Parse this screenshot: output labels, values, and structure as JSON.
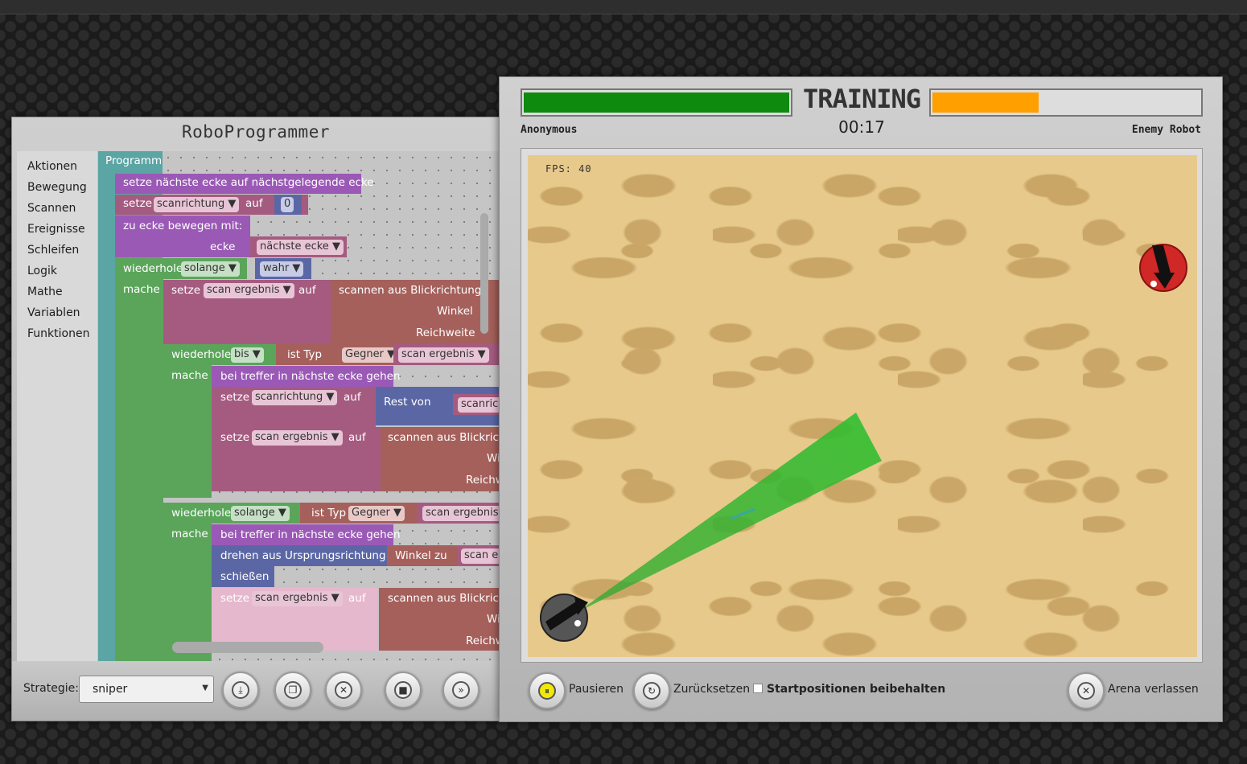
{
  "programmer": {
    "title": "RoboProgrammer",
    "categories": [
      "Aktionen",
      "Bewegung",
      "Scannen",
      "Ereignisse",
      "Schleifen",
      "Logik",
      "Mathe",
      "Variablen",
      "Funktionen"
    ],
    "blocks": {
      "programm": "Programm",
      "nearest_corner": "setze nächste ecke auf nächstgelegende ecke",
      "setze": "setze",
      "auf": "auf",
      "scanrichtung": "scanrichtung",
      "zero": "0",
      "move_corner": "zu ecke bewegen  mit:",
      "ecke": "ecke",
      "naechste_ecke": "nächste ecke",
      "wiederhole": "wiederhole",
      "solange": "solange",
      "wahr": "wahr",
      "mache": "mache",
      "scan_ergebnis": "scan ergebnis",
      "scannen_aus": "scannen aus Blickrichtung",
      "scannen_aus_cut": "scannen aus Blickricht",
      "winkel": "Winkel",
      "winkel_cut": "Wi",
      "reichweite": "Reichweite",
      "reichweite_cut": "Reichw",
      "bis": "bis",
      "ist_typ": "ist Typ",
      "gegner": "Gegner",
      "bei_treffer": "bei treffer in nächste ecke gehen",
      "rest_von": "Rest von",
      "scanric": "scanric",
      "drehen": "drehen aus Ursprungsrichtung",
      "winkel_zu": "Winkel zu",
      "scan_e": "scan e",
      "schiessen": "schießen"
    },
    "strategy_label": "Strategie:",
    "strategy_value": "sniper",
    "buttons": [
      {
        "name": "download-icon",
        "glyph": "⤓"
      },
      {
        "name": "copy-icon",
        "glyph": "❐"
      },
      {
        "name": "close-icon",
        "glyph": "✕"
      },
      {
        "name": "stop-icon",
        "glyph": "■"
      },
      {
        "name": "fast-forward-icon",
        "glyph": "»"
      }
    ]
  },
  "arena": {
    "title": "TRAINING",
    "timer": "00:17",
    "player": {
      "name": "Anonymous",
      "health": 1.0,
      "color": "#0e8a0e"
    },
    "enemy": {
      "name": "Enemy Robot",
      "health": 0.4,
      "color": "#ff9f00"
    },
    "fps": "FPS: 40",
    "pause_label": "Pausieren",
    "reset_label": "Zurücksetzen",
    "keep_positions_label": "Startpositionen beibehalten",
    "leave_label": "Arena verlassen"
  }
}
